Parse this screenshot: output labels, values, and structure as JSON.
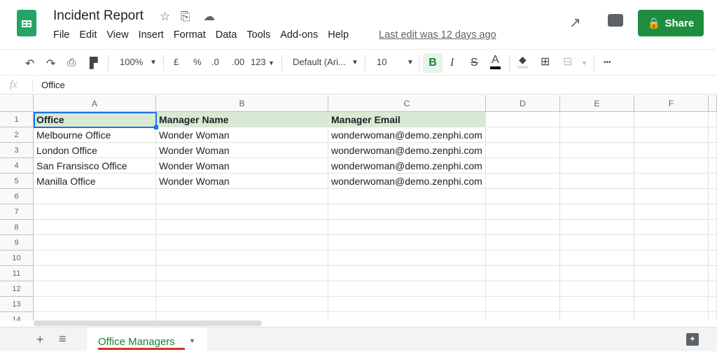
{
  "doc": {
    "title": "Incident Report",
    "last_edit": "Last edit was 12 days ago",
    "share": "Share"
  },
  "menu": [
    "File",
    "Edit",
    "View",
    "Insert",
    "Format",
    "Data",
    "Tools",
    "Add-ons",
    "Help"
  ],
  "toolbar": {
    "zoom": "100%",
    "currency": "£",
    "percent": "%",
    "dec_less": ".0",
    "dec_more": ".00",
    "format": "123",
    "font": "Default (Ari...",
    "size": "10",
    "bold": "B",
    "italic": "I",
    "strike": "S",
    "text_color": "A",
    "more": "•••"
  },
  "formula": {
    "fx": "fx",
    "value": "Office"
  },
  "columns": [
    "A",
    "B",
    "C",
    "D",
    "E",
    "F"
  ],
  "rows": [
    "1",
    "2",
    "3",
    "4",
    "5",
    "6",
    "7",
    "8",
    "9",
    "10",
    "11",
    "12",
    "13",
    "14"
  ],
  "cells": [
    [
      "Office",
      "Manager Name",
      "Manager Email"
    ],
    [
      "Melbourne Office",
      "Wonder Woman",
      "wonderwoman@demo.zenphi.com"
    ],
    [
      "London Office",
      "Wonder Woman",
      "wonderwoman@demo.zenphi.com"
    ],
    [
      "San Fransisco Office",
      "Wonder Woman",
      "wonderwoman@demo.zenphi.com"
    ],
    [
      "Manilla Office",
      "Wonder Woman",
      "wonderwoman@demo.zenphi.com"
    ]
  ],
  "sheet": {
    "tab": "Office Managers",
    "add": "+",
    "list": "≡"
  },
  "colors": {
    "accent": "#1e8e3e",
    "header_fill": "#d9ead3",
    "selection": "#1a73e8"
  }
}
